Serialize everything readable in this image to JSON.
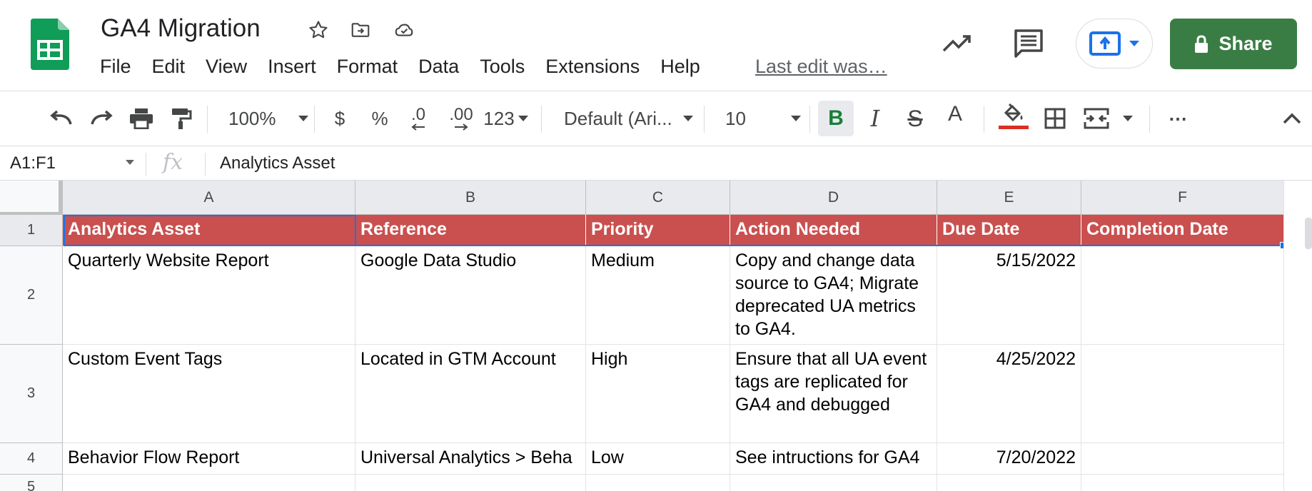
{
  "app": {
    "doc_title": "GA4 Migration",
    "menus": [
      "File",
      "Edit",
      "View",
      "Insert",
      "Format",
      "Data",
      "Tools",
      "Extensions",
      "Help"
    ],
    "last_edit": "Last edit was…",
    "share_label": "Share"
  },
  "toolbar": {
    "zoom": "100%",
    "currency": "$",
    "percent": "%",
    "decrease_decimal": ".0",
    "increase_decimal": ".00",
    "number_format": "123",
    "font": "Default (Ari...",
    "font_size": "10",
    "bold": "B",
    "italic": "I",
    "strikethrough": "S",
    "text_color": "A",
    "more": "⋯",
    "fill_color_accent": "#d93025"
  },
  "formula_bar": {
    "name_box": "A1:F1",
    "formula": "Analytics Asset"
  },
  "sheet": {
    "columns": [
      "A",
      "B",
      "C",
      "D",
      "E",
      "F"
    ],
    "rows": [
      "1",
      "2",
      "3",
      "4",
      "5"
    ],
    "header_fill": "#c9504f",
    "cells": [
      [
        "Analytics Asset",
        "Reference",
        "Priority",
        "Action Needed",
        "Due Date",
        "Completion Date"
      ],
      [
        "Quarterly Website Report",
        "Google Data Studio",
        "Medium",
        "Copy and change data source to GA4; Migrate deprecated UA metrics to GA4.",
        "5/15/2022",
        ""
      ],
      [
        "Custom Event Tags",
        "Located in GTM Account",
        "High",
        "Ensure that all UA event tags are replicated for GA4 and debugged",
        "4/25/2022",
        ""
      ],
      [
        "Behavior Flow Report",
        "Universal Analytics > Beha",
        "Low",
        "See intructions for GA4",
        "7/20/2022",
        ""
      ],
      [
        "",
        "",
        "",
        "",
        "",
        ""
      ]
    ]
  }
}
